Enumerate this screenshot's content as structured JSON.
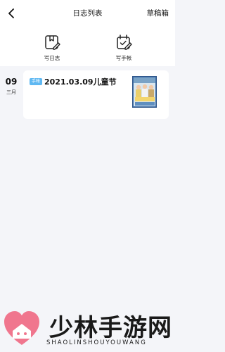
{
  "header": {
    "title": "日志列表",
    "drafts_label": "草稿箱",
    "back_icon": "chevron-left-icon"
  },
  "actions": [
    {
      "label": "写日志",
      "icon": "write-diary-icon"
    },
    {
      "label": "写手帐",
      "icon": "write-journal-icon"
    }
  ],
  "entries": [
    {
      "day": "09",
      "month": "三月",
      "tag": "手帐",
      "title": "2021.03.09儿童节",
      "thumbnail": "journal-thumbnail-image"
    }
  ],
  "watermark": {
    "title": "少林手游网",
    "subtitle": "SHAOLINSHOUYOUWANG"
  },
  "colors": {
    "background": "#f4f5f9",
    "tag": "#5fb8f2",
    "brand_pink": "#f0768e"
  }
}
